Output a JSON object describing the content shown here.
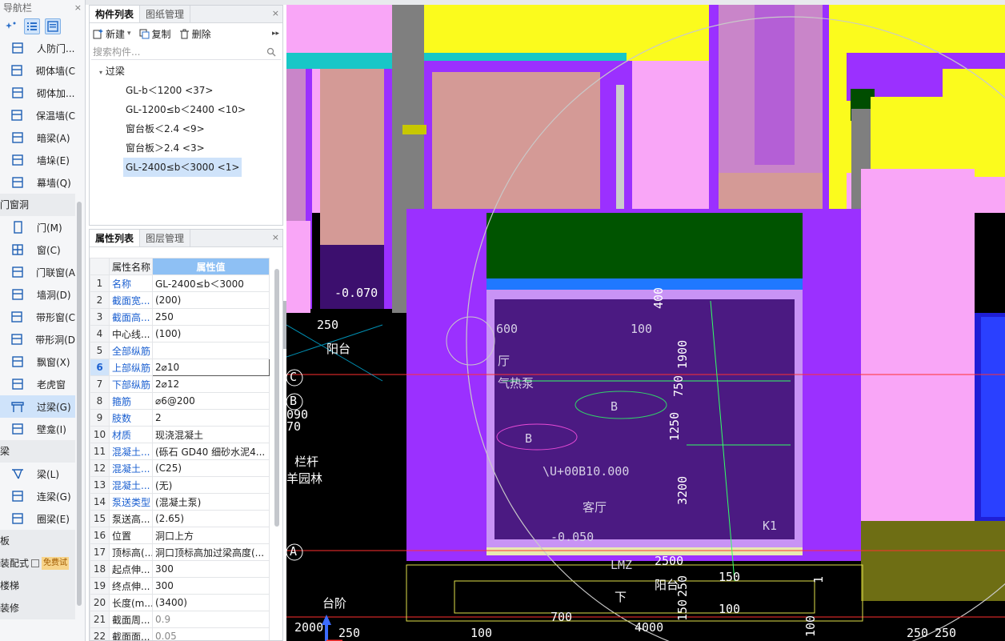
{
  "nav": {
    "title": "导航栏",
    "close": "×",
    "items": [
      {
        "label": "人防门...",
        "icon": "civil-door-icon"
      },
      {
        "label": "砌体墙(C",
        "icon": "masonry-wall-icon"
      },
      {
        "label": "砌体加...",
        "icon": "masonry-rebar-icon"
      },
      {
        "label": "保温墙(C",
        "icon": "insulation-wall-icon"
      },
      {
        "label": "暗梁(A)",
        "icon": "hidden-beam-icon"
      },
      {
        "label": "墙垛(E)",
        "icon": "wall-pier-icon"
      },
      {
        "label": "幕墙(Q)",
        "icon": "curtain-wall-icon"
      }
    ],
    "group_door": "门窗洞",
    "door_items": [
      {
        "label": "门(M)",
        "icon": "door-icon"
      },
      {
        "label": "窗(C)",
        "icon": "window-icon"
      },
      {
        "label": "门联窗(A",
        "icon": "door-window-icon"
      },
      {
        "label": "墙洞(D)",
        "icon": "wall-hole-icon"
      },
      {
        "label": "带形窗(C",
        "icon": "strip-window-icon"
      },
      {
        "label": "带形洞(D",
        "icon": "strip-hole-icon"
      },
      {
        "label": "飘窗(X)",
        "icon": "bay-window-icon"
      },
      {
        "label": "老虎窗",
        "icon": "dormer-icon"
      },
      {
        "label": "过梁(G)",
        "icon": "lintel-icon"
      },
      {
        "label": "壁龛(I)",
        "icon": "niche-icon"
      }
    ],
    "group_beam": "梁",
    "beam_items": [
      {
        "label": "梁(L)",
        "icon": "beam-icon"
      },
      {
        "label": "连梁(G)",
        "icon": "coupling-beam-icon"
      },
      {
        "label": "圈梁(E)",
        "icon": "ring-beam-icon"
      }
    ],
    "group_slab": "板",
    "group_prefab": "装配式",
    "free_badge": "免费试",
    "group_stair": "楼梯",
    "group_decor": "装修"
  },
  "component_panel": {
    "tab1": "构件列表",
    "tab2": "图纸管理",
    "close": "×",
    "btn_new": "新建",
    "btn_copy": "复制",
    "btn_delete": "删除",
    "more": "▸▸",
    "search_placeholder": "搜索构件...",
    "tree_root": "过梁",
    "tree_items": [
      "GL-b＜1200 <37>",
      "GL-1200≤b＜2400 <10>",
      "窗台板＜2.4 <9>",
      "窗台板＞2.4 <3>",
      "GL-2400≤b＜3000 <1>"
    ]
  },
  "prop_panel": {
    "tab1": "属性列表",
    "tab2": "图层管理",
    "close": "×",
    "col_name": "属性名称",
    "col_value": "属性值",
    "rows": [
      {
        "n": "1",
        "k": "名称",
        "v": "GL-2400≤b＜3000",
        "blue": true
      },
      {
        "n": "2",
        "k": "截面宽...",
        "v": "(200)",
        "blue": true
      },
      {
        "n": "3",
        "k": "截面高...",
        "v": "250",
        "blue": true
      },
      {
        "n": "4",
        "k": "中心线...",
        "v": "(100)",
        "blue": false
      },
      {
        "n": "5",
        "k": "全部纵筋",
        "v": "",
        "blue": true
      },
      {
        "n": "6",
        "k": "上部纵筋",
        "v": "2⌀10",
        "blue": true
      },
      {
        "n": "7",
        "k": "下部纵筋",
        "v": "2⌀12",
        "blue": true
      },
      {
        "n": "8",
        "k": "箍筋",
        "v": "⌀6@200",
        "blue": true
      },
      {
        "n": "9",
        "k": "肢数",
        "v": "2",
        "blue": true
      },
      {
        "n": "10",
        "k": "材质",
        "v": "现浇混凝土",
        "blue": true
      },
      {
        "n": "11",
        "k": "混凝土...",
        "v": "(砾石 GD40 细砂水泥4...",
        "blue": true
      },
      {
        "n": "12",
        "k": "混凝土...",
        "v": "(C25)",
        "blue": true
      },
      {
        "n": "13",
        "k": "混凝土...",
        "v": "(无)",
        "blue": true
      },
      {
        "n": "14",
        "k": "泵送类型",
        "v": "(混凝土泵)",
        "blue": true
      },
      {
        "n": "15",
        "k": "泵送高...",
        "v": "(2.65)",
        "blue": false
      },
      {
        "n": "16",
        "k": "位置",
        "v": "洞口上方",
        "blue": false
      },
      {
        "n": "17",
        "k": "顶标高(...",
        "v": "洞口顶标高加过梁高度(...",
        "blue": false
      },
      {
        "n": "18",
        "k": "起点伸...",
        "v": "300",
        "blue": false
      },
      {
        "n": "19",
        "k": "终点伸...",
        "v": "300",
        "blue": false
      },
      {
        "n": "20",
        "k": "长度(m...",
        "v": "(3400)",
        "blue": false
      },
      {
        "n": "21",
        "k": "截面周...",
        "v": "0.9",
        "blue": false
      },
      {
        "n": "22",
        "k": "截面面...",
        "v": "0.05",
        "blue": false
      }
    ]
  },
  "cad": {
    "labels": [
      "-0.070",
      "250",
      "阳台",
      "C",
      "B",
      "090",
      "70",
      "栏杆",
      "羊园林",
      "A",
      "台阶",
      "2000",
      "250",
      "100",
      "4000",
      "250",
      "250",
      "100",
      "250",
      "1250",
      "750",
      "1900",
      "400",
      "3200",
      "600",
      "100",
      "厅",
      "气热泵",
      "B",
      "B",
      "\\U+00B10.000",
      "客厅",
      "-0.050",
      "K1",
      "LMZ",
      "阳台",
      "1",
      "150",
      "150",
      "100",
      "700",
      "2500",
      "下"
    ]
  }
}
